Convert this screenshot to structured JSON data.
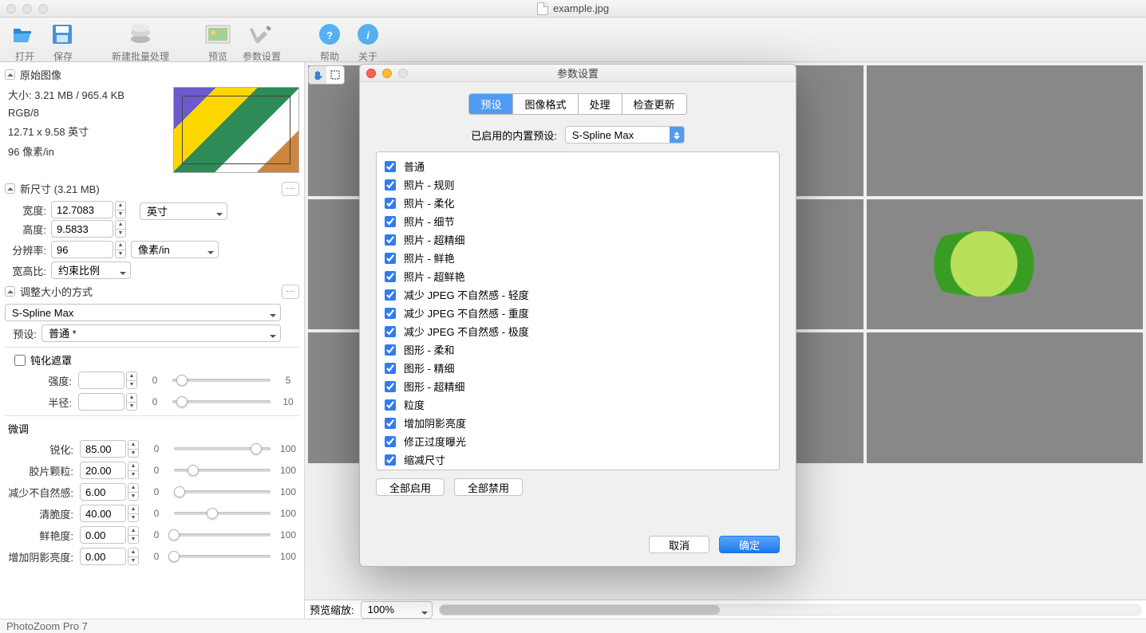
{
  "title": {
    "filename": "example.jpg"
  },
  "toolbar": {
    "open": "打开",
    "save": "保存",
    "newbatch": "新建批量处理",
    "preview": "预览",
    "settings": "参数设置",
    "help": "帮助",
    "about": "关于"
  },
  "left": {
    "sec_original": "原始图像",
    "info_size": "大小: 3.21 MB / 965.4 KB",
    "info_mode": "RGB/8",
    "info_dim": "12.71 x 9.58 英寸",
    "info_res": "96 像素/in",
    "sec_newsize": "新尺寸 (3.21 MB)",
    "width_lab": "宽度:",
    "width_val": "12.7083",
    "height_lab": "高度:",
    "height_val": "9.5833",
    "unit": "英寸",
    "res_lab": "分辨率:",
    "res_val": "96",
    "res_unit": "像素/in",
    "aspect_lab": "宽高比:",
    "aspect_val": "约束比例",
    "sec_method": "调整大小的方式",
    "method_val": "S-Spline Max",
    "preset_lab": "预设:",
    "preset_val": "普通 *",
    "unsharp_chk": "钝化遮罩",
    "intensity_lab": "强度:",
    "intensity_min": "0",
    "intensity_max": "5",
    "radius_lab": "半径:",
    "radius_min": "0",
    "radius_max": "10",
    "finetune_lab": "微调",
    "params": [
      {
        "lab": "锐化:",
        "val": "85.00",
        "min": "0",
        "max": "100",
        "pos": 85
      },
      {
        "lab": "胶片颗粒:",
        "val": "20.00",
        "min": "0",
        "max": "100",
        "pos": 20
      },
      {
        "lab": "减少不自然感:",
        "val": "6.00",
        "min": "0",
        "max": "100",
        "pos": 6
      },
      {
        "lab": "清脆度:",
        "val": "40.00",
        "min": "0",
        "max": "100",
        "pos": 40
      },
      {
        "lab": "鲜艳度:",
        "val": "0.00",
        "min": "0",
        "max": "100",
        "pos": 0
      },
      {
        "lab": "增加阴影亮度:",
        "val": "0.00",
        "min": "0",
        "max": "100",
        "pos": 0
      }
    ]
  },
  "previewbar": {
    "label": "预览缩放:",
    "zoom": "100%"
  },
  "modal": {
    "title": "参数设置",
    "tabs": [
      "预设",
      "图像格式",
      "处理",
      "检查更新"
    ],
    "active_tab": 0,
    "preset_label": "已启用的内置预设:",
    "preset_value": "S-Spline Max",
    "items": [
      "普通",
      "照片 - 规则",
      "照片 - 柔化",
      "照片 - 细节",
      "照片 - 超精细",
      "照片 - 鲜艳",
      "照片 - 超鲜艳",
      "减少 JPEG 不自然感 - 轻度",
      "减少 JPEG 不自然感 - 重度",
      "减少 JPEG 不自然感 - 极度",
      "图形 - 柔和",
      "图形 - 精细",
      "图形 - 超精细",
      "粒度",
      "增加阴影亮度",
      "修正过度曝光",
      "缩减尺寸"
    ],
    "enable_all": "全部启用",
    "disable_all": "全部禁用",
    "cancel": "取消",
    "ok": "确定"
  },
  "status": {
    "app": "PhotoZoom Pro 7"
  }
}
